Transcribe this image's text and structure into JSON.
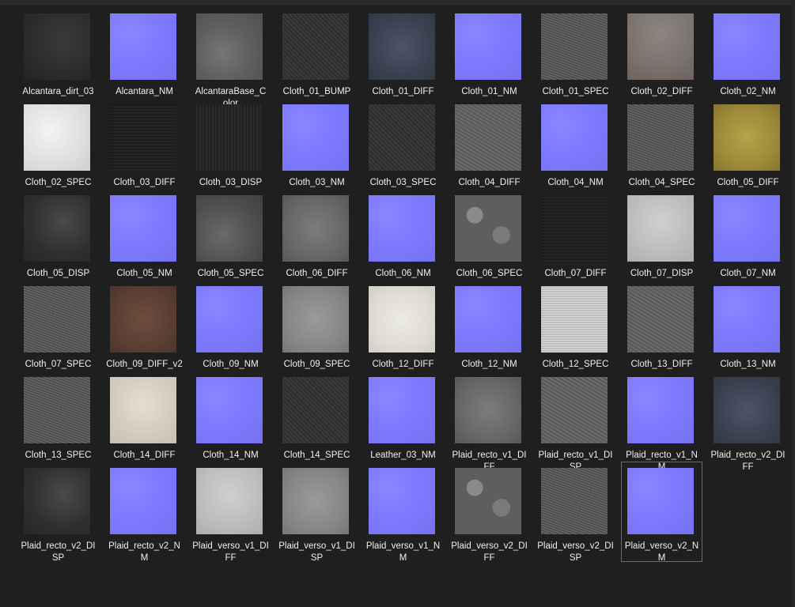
{
  "files": [
    {
      "name": "Alcantara_dirt_03",
      "label_lines": [
        "Alcantara_dirt_03"
      ],
      "kind": "dirt"
    },
    {
      "name": "Alcantara_NM",
      "label_lines": [
        "Alcantara_NM"
      ],
      "kind": "nm"
    },
    {
      "name": "AlcantaraBase_Color",
      "label_lines": [
        "AlcantaraBase_C",
        "olor"
      ],
      "kind": "gray"
    },
    {
      "name": "Cloth_01_BUMP",
      "label_lines": [
        "Cloth_01_BUMP"
      ],
      "kind": "darkfabric"
    },
    {
      "name": "Cloth_01_DIFF",
      "label_lines": [
        "Cloth_01_DIFF"
      ],
      "kind": "bluegray"
    },
    {
      "name": "Cloth_01_NM",
      "label_lines": [
        "Cloth_01_NM"
      ],
      "kind": "nm"
    },
    {
      "name": "Cloth_01_SPEC",
      "label_lines": [
        "Cloth_01_SPEC"
      ],
      "kind": "noise"
    },
    {
      "name": "Cloth_02_DIFF",
      "label_lines": [
        "Cloth_02_DIFF"
      ],
      "kind": "warmgray"
    },
    {
      "name": "Cloth_02_NM",
      "label_lines": [
        "Cloth_02_NM"
      ],
      "kind": "nm"
    },
    {
      "name": "Cloth_02_SPEC",
      "label_lines": [
        "Cloth_02_SPEC"
      ],
      "kind": "white"
    },
    {
      "name": "Cloth_03_DIFF",
      "label_lines": [
        "Cloth_03_DIFF"
      ],
      "kind": "black"
    },
    {
      "name": "Cloth_03_DISP",
      "label_lines": [
        "Cloth_03_DISP"
      ],
      "kind": "black2"
    },
    {
      "name": "Cloth_03_NM",
      "label_lines": [
        "Cloth_03_NM"
      ],
      "kind": "nm"
    },
    {
      "name": "Cloth_03_SPEC",
      "label_lines": [
        "Cloth_03_SPEC"
      ],
      "kind": "darkfabric"
    },
    {
      "name": "Cloth_04_DIFF",
      "label_lines": [
        "Cloth_04_DIFF"
      ],
      "kind": "midgray"
    },
    {
      "name": "Cloth_04_NM",
      "label_lines": [
        "Cloth_04_NM"
      ],
      "kind": "nm"
    },
    {
      "name": "Cloth_04_SPEC",
      "label_lines": [
        "Cloth_04_SPEC"
      ],
      "kind": "noise"
    },
    {
      "name": "Cloth_05_DIFF",
      "label_lines": [
        "Cloth_05_DIFF"
      ],
      "kind": "yellow"
    },
    {
      "name": "Cloth_05_DISP",
      "label_lines": [
        "Cloth_05_DISP"
      ],
      "kind": "darkwrinkle"
    },
    {
      "name": "Cloth_05_NM",
      "label_lines": [
        "Cloth_05_NM"
      ],
      "kind": "nm"
    },
    {
      "name": "Cloth_05_SPEC",
      "label_lines": [
        "Cloth_05_SPEC"
      ],
      "kind": "wrinkle"
    },
    {
      "name": "Cloth_06_DIFF",
      "label_lines": [
        "Cloth_06_DIFF"
      ],
      "kind": "stonegray"
    },
    {
      "name": "Cloth_06_NM",
      "label_lines": [
        "Cloth_06_NM"
      ],
      "kind": "nm"
    },
    {
      "name": "Cloth_06_SPEC",
      "label_lines": [
        "Cloth_06_SPEC"
      ],
      "kind": "mottled"
    },
    {
      "name": "Cloth_07_DIFF",
      "label_lines": [
        "Cloth_07_DIFF"
      ],
      "kind": "black"
    },
    {
      "name": "Cloth_07_DISP",
      "label_lines": [
        "Cloth_07_DISP"
      ],
      "kind": "light"
    },
    {
      "name": "Cloth_07_NM",
      "label_lines": [
        "Cloth_07_NM"
      ],
      "kind": "nm"
    },
    {
      "name": "Cloth_07_SPEC",
      "label_lines": [
        "Cloth_07_SPEC"
      ],
      "kind": "noise"
    },
    {
      "name": "Cloth_09_DIFF_v2",
      "label_lines": [
        "Cloth_09_DIFF_v2"
      ],
      "kind": "leather"
    },
    {
      "name": "Cloth_09_NM",
      "label_lines": [
        "Cloth_09_NM"
      ],
      "kind": "nm"
    },
    {
      "name": "Cloth_09_SPEC",
      "label_lines": [
        "Cloth_09_SPEC"
      ],
      "kind": "lightgray"
    },
    {
      "name": "Cloth_12_DIFF",
      "label_lines": [
        "Cloth_12_DIFF"
      ],
      "kind": "cream"
    },
    {
      "name": "Cloth_12_NM",
      "label_lines": [
        "Cloth_12_NM"
      ],
      "kind": "nm"
    },
    {
      "name": "Cloth_12_SPEC",
      "label_lines": [
        "Cloth_12_SPEC"
      ],
      "kind": "scratch"
    },
    {
      "name": "Cloth_13_DIFF",
      "label_lines": [
        "Cloth_13_DIFF"
      ],
      "kind": "midgray"
    },
    {
      "name": "Cloth_13_NM",
      "label_lines": [
        "Cloth_13_NM"
      ],
      "kind": "nm"
    },
    {
      "name": "Cloth_13_SPEC",
      "label_lines": [
        "Cloth_13_SPEC"
      ],
      "kind": "noise"
    },
    {
      "name": "Cloth_14_DIFF",
      "label_lines": [
        "Cloth_14_DIFF"
      ],
      "kind": "beige"
    },
    {
      "name": "Cloth_14_NM",
      "label_lines": [
        "Cloth_14_NM"
      ],
      "kind": "nm"
    },
    {
      "name": "Cloth_14_SPEC",
      "label_lines": [
        "Cloth_14_SPEC"
      ],
      "kind": "darkfabric"
    },
    {
      "name": "Leather_03_NM",
      "label_lines": [
        "Leather_03_NM"
      ],
      "kind": "nm"
    },
    {
      "name": "Plaid_recto_v1_DIFF",
      "label_lines": [
        "Plaid_recto_v1_DI",
        "FF"
      ],
      "kind": "stonegray"
    },
    {
      "name": "Plaid_recto_v1_DISP",
      "label_lines": [
        "Plaid_recto_v1_DI",
        "SP"
      ],
      "kind": "midgray"
    },
    {
      "name": "Plaid_recto_v1_NM",
      "label_lines": [
        "Plaid_recto_v1_N",
        "M"
      ],
      "kind": "nm"
    },
    {
      "name": "Plaid_recto_v2_DIFF",
      "label_lines": [
        "Plaid_recto_v2_DI",
        "FF"
      ],
      "kind": "bluegray"
    },
    {
      "name": "Plaid_recto_v2_DISP",
      "label_lines": [
        "Plaid_recto_v2_DI",
        "SP"
      ],
      "kind": "darkwrinkle"
    },
    {
      "name": "Plaid_recto_v2_NM",
      "label_lines": [
        "Plaid_recto_v2_N",
        "M"
      ],
      "kind": "nm"
    },
    {
      "name": "Plaid_verso_v1_DIFF",
      "label_lines": [
        "Plaid_verso_v1_DI",
        "FF"
      ],
      "kind": "light"
    },
    {
      "name": "Plaid_verso_v1_DISP",
      "label_lines": [
        "Plaid_verso_v1_DI",
        "SP"
      ],
      "kind": "lightgray"
    },
    {
      "name": "Plaid_verso_v1_NM",
      "label_lines": [
        "Plaid_verso_v1_N",
        "M"
      ],
      "kind": "nm"
    },
    {
      "name": "Plaid_verso_v2_DIFF",
      "label_lines": [
        "Plaid_verso_v2_DI",
        "FF"
      ],
      "kind": "mottled"
    },
    {
      "name": "Plaid_verso_v2_DISP",
      "label_lines": [
        "Plaid_verso_v2_DI",
        "SP"
      ],
      "kind": "noise"
    },
    {
      "name": "Plaid_verso_v2_NM",
      "label_lines": [
        "Plaid_verso_v2_N",
        "M"
      ],
      "kind": "nm",
      "selected": true
    }
  ],
  "row_lengths": [
    9,
    9,
    9,
    9,
    9,
    8
  ]
}
